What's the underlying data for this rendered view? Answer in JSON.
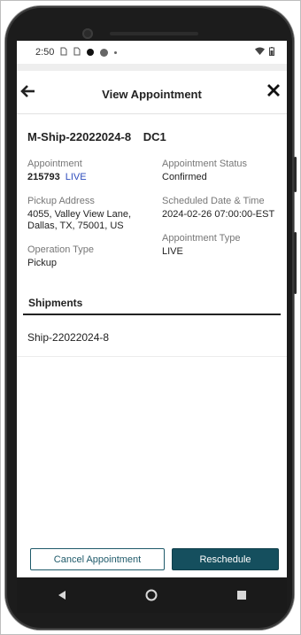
{
  "status_bar": {
    "time": "2:50",
    "sim_icons": [
      "sim-card-icon",
      "sim-card-icon"
    ]
  },
  "header": {
    "title": "View Appointment",
    "back_icon": "back-arrow-icon",
    "close_icon": "close-icon"
  },
  "appointment": {
    "shipment_id": "M-Ship-22022024-8",
    "dc": "DC1",
    "fields": {
      "appointment": {
        "label": "Appointment",
        "number": "215793",
        "tag": "LIVE"
      },
      "status": {
        "label": "Appointment Status",
        "value": "Confirmed"
      },
      "pickup_address": {
        "label": "Pickup Address",
        "value": "4055, Valley View Lane, Dallas, TX, 75001, US"
      },
      "scheduled": {
        "label": "Scheduled Date & Time",
        "value": "2024-02-26 07:00:00-EST"
      },
      "operation_type": {
        "label": "Operation Type",
        "value": "Pickup"
      },
      "appointment_type": {
        "label": "Appointment Type",
        "value": "LIVE"
      }
    }
  },
  "shipments": {
    "title": "Shipments",
    "items": [
      "Ship-22022024-8"
    ]
  },
  "actions": {
    "cancel_label": "Cancel Appointment",
    "reschedule_label": "Reschedule"
  },
  "colors": {
    "primary": "#154f5e",
    "live_tag": "#2e4dbd"
  },
  "nav": [
    "back-triangle-icon",
    "home-circle-icon",
    "recents-square-icon"
  ]
}
